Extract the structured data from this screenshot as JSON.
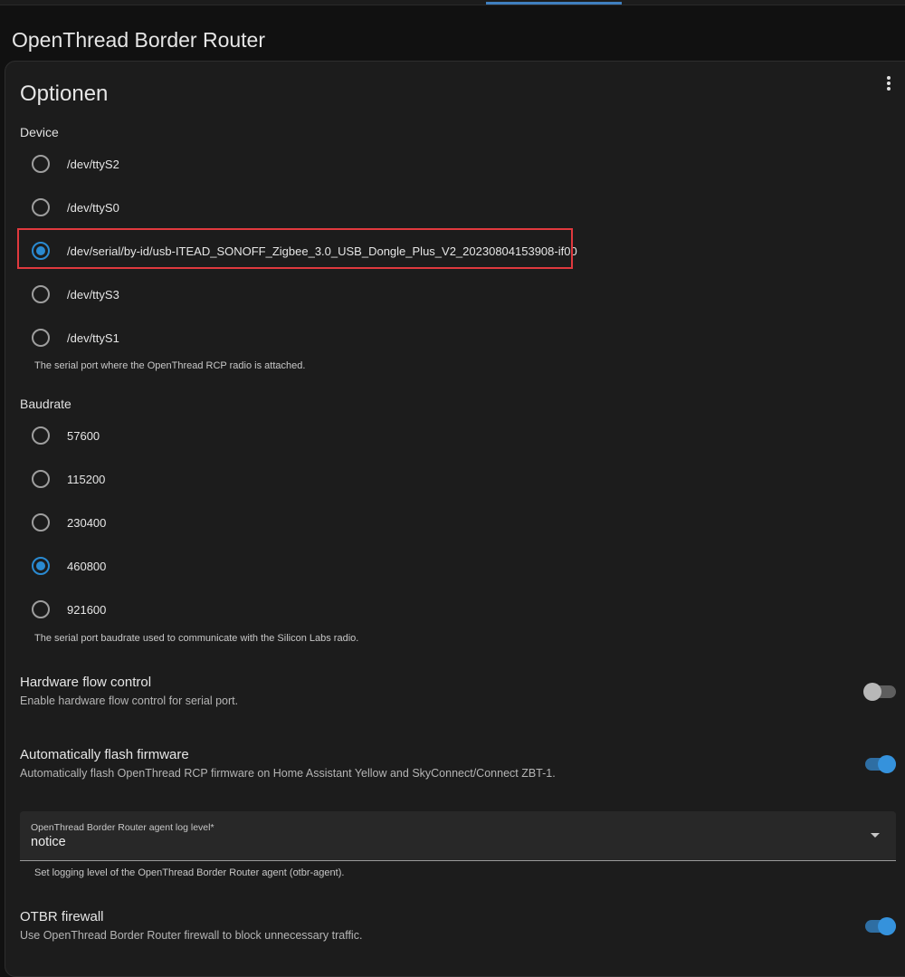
{
  "page": {
    "title": "OpenThread Border Router"
  },
  "card": {
    "title": "Optionen",
    "menu_icon": "dots-vertical-icon"
  },
  "device": {
    "label": "Device",
    "options": [
      {
        "label": "/dev/ttyS2",
        "checked": false
      },
      {
        "label": "/dev/ttyS0",
        "checked": false
      },
      {
        "label": "/dev/serial/by-id/usb-ITEAD_SONOFF_Zigbee_3.0_USB_Dongle_Plus_V2_20230804153908-if00",
        "checked": true
      },
      {
        "label": "/dev/ttyS3",
        "checked": false
      },
      {
        "label": "/dev/ttyS1",
        "checked": false
      }
    ],
    "helper": "The serial port where the OpenThread RCP radio is attached."
  },
  "baudrate": {
    "label": "Baudrate",
    "options": [
      {
        "label": "57600",
        "checked": false
      },
      {
        "label": "115200",
        "checked": false
      },
      {
        "label": "230400",
        "checked": false
      },
      {
        "label": "460800",
        "checked": true
      },
      {
        "label": "921600",
        "checked": false
      }
    ],
    "helper": "The serial port baudrate used to communicate with the Silicon Labs radio."
  },
  "hardware_flow_control": {
    "title": "Hardware flow control",
    "description": "Enable hardware flow control for serial port.",
    "enabled": false
  },
  "auto_flash": {
    "title": "Automatically flash firmware",
    "description": "Automatically flash OpenThread RCP firmware on Home Assistant Yellow and SkyConnect/Connect ZBT-1.",
    "enabled": true
  },
  "log_level": {
    "label": "OpenThread Border Router agent log level*",
    "value": "notice",
    "helper": "Set logging level of the OpenThread Border Router agent (otbr-agent)."
  },
  "firewall": {
    "title": "OTBR firewall",
    "description": "Use OpenThread Border Router firewall to block unnecessary traffic.",
    "enabled": true
  },
  "colors": {
    "accent": "#2a8ad1",
    "highlight_border": "#e0393e",
    "background": "#111111",
    "card": "#1c1c1c"
  }
}
